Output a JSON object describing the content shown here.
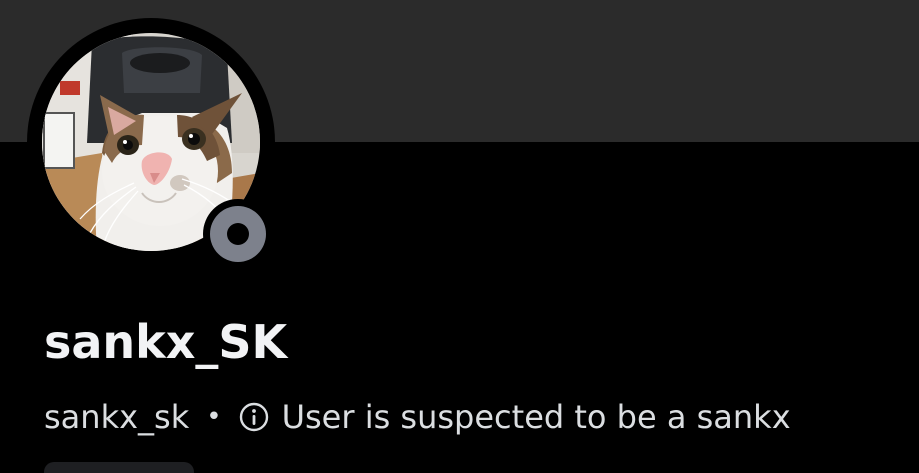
{
  "profile": {
    "display_name": "sankx_SK",
    "username": "sankx_sk",
    "separator": "•",
    "note": "User is suspected to be a sankx",
    "status": "offline"
  },
  "icons": {
    "info": "info-circle-icon",
    "status": "offline-status-icon"
  },
  "colors": {
    "banner": "#2b2b2b",
    "background": "#000000",
    "status_offline": "#7d818c",
    "text_primary": "#f2f3f5",
    "text_secondary": "#dbdee1"
  }
}
